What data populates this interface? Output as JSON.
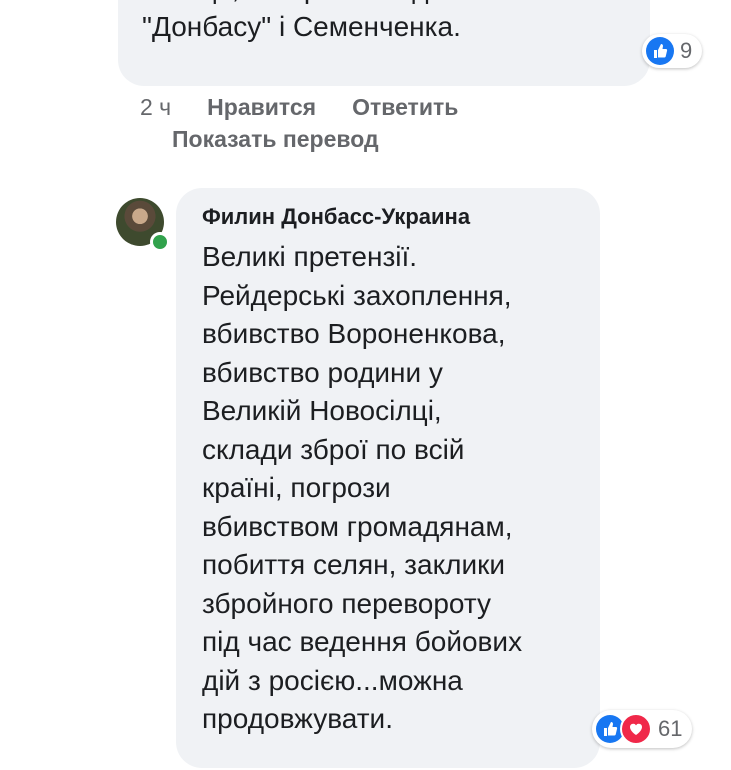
{
  "comment1": {
    "lines": [
      "Так що, які претензії до",
      "\"Донбасу\" і Семенченка."
    ],
    "reaction_count": "9"
  },
  "comment1_meta": {
    "time": "2 ч",
    "like_label": "Нравится",
    "reply_label": "Ответить",
    "translate_label": "Показать перевод"
  },
  "comment2": {
    "author": "Филин Донбасс-Украина",
    "lines": [
      "Великі претензії.",
      "Рейдерські захоплення,",
      "вбивство Вороненкова,",
      "вбивство родини у",
      "Великій Новосілці,",
      "склади зброї по всій",
      "країні, погрози",
      "вбивством громадянам,",
      "побиття селян, заклики",
      "збройного перевороту",
      "під час ведення бойових",
      "дій з росією...можна",
      "продовжувати."
    ],
    "reaction_count": "61"
  },
  "icons": {
    "like": "thumbs-up-icon",
    "love": "heart-icon"
  },
  "colors": {
    "bubble_bg": "#f0f2f5",
    "like_blue": "#1877f2",
    "love_red": "#f02849",
    "meta_gray": "#65676b",
    "online_green": "#31a24c"
  }
}
